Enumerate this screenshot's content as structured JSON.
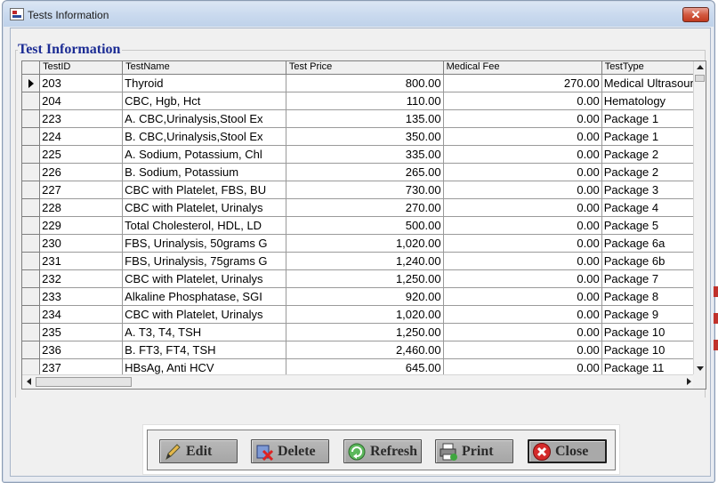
{
  "window": {
    "title": "Tests Information",
    "close_glyph": "✕"
  },
  "group": {
    "title": "Test Information"
  },
  "grid": {
    "columns": [
      "TestID",
      "TestName",
      "Test Price",
      "Medical Fee",
      "TestType"
    ],
    "selected_row": 0,
    "rows": [
      [
        "203",
        "Thyroid",
        "800.00",
        "270.00",
        "Medical Ultrasound"
      ],
      [
        "204",
        "CBC, Hgb, Hct",
        "110.00",
        "0.00",
        "Hematology"
      ],
      [
        "223",
        "A. CBC,Urinalysis,Stool Ex",
        "135.00",
        "0.00",
        "Package 1"
      ],
      [
        "224",
        "B. CBC,Urinalysis,Stool Ex",
        "350.00",
        "0.00",
        "Package 1"
      ],
      [
        "225",
        "A. Sodium, Potassium, Chl",
        "335.00",
        "0.00",
        "Package 2"
      ],
      [
        "226",
        "B. Sodium, Potassium",
        "265.00",
        "0.00",
        "Package 2"
      ],
      [
        "227",
        "CBC with Platelet, FBS, BU",
        "730.00",
        "0.00",
        "Package 3"
      ],
      [
        "228",
        "CBC with Platelet, Urinalys",
        "270.00",
        "0.00",
        "Package 4"
      ],
      [
        "229",
        "Total Cholesterol, HDL, LD",
        "500.00",
        "0.00",
        "Package 5"
      ],
      [
        "230",
        "FBS, Urinalysis, 50grams G",
        "1,020.00",
        "0.00",
        "Package 6a"
      ],
      [
        "231",
        "FBS, Urinalysis, 75grams G",
        "1,240.00",
        "0.00",
        "Package 6b"
      ],
      [
        "232",
        "CBC with Platelet, Urinalys",
        "1,250.00",
        "0.00",
        "Package 7"
      ],
      [
        "233",
        "Alkaline Phosphatase, SGI",
        "920.00",
        "0.00",
        "Package 8"
      ],
      [
        "234",
        "CBC with Platelet, Urinalys",
        "1,020.00",
        "0.00",
        "Package 9"
      ],
      [
        "235",
        "A. T3, T4, TSH",
        "1,250.00",
        "0.00",
        "Package 10"
      ],
      [
        "236",
        "B. FT3, FT4, TSH",
        "2,460.00",
        "0.00",
        "Package 10"
      ],
      [
        "237",
        "HBsAg, Anti HCV",
        "645.00",
        "0.00",
        "Package 11"
      ]
    ]
  },
  "toolbar": {
    "edit": "Edit",
    "delete": "Delete",
    "refresh": "Refresh",
    "print": "Print",
    "close": "Close"
  },
  "icons": {
    "edit": "pencil-icon",
    "delete": "delete-icon",
    "refresh": "refresh-icon",
    "print": "printer-icon",
    "close": "close-icon"
  },
  "colors": {
    "group_title": "#1c2c94",
    "close_button": "#c23a1f"
  }
}
